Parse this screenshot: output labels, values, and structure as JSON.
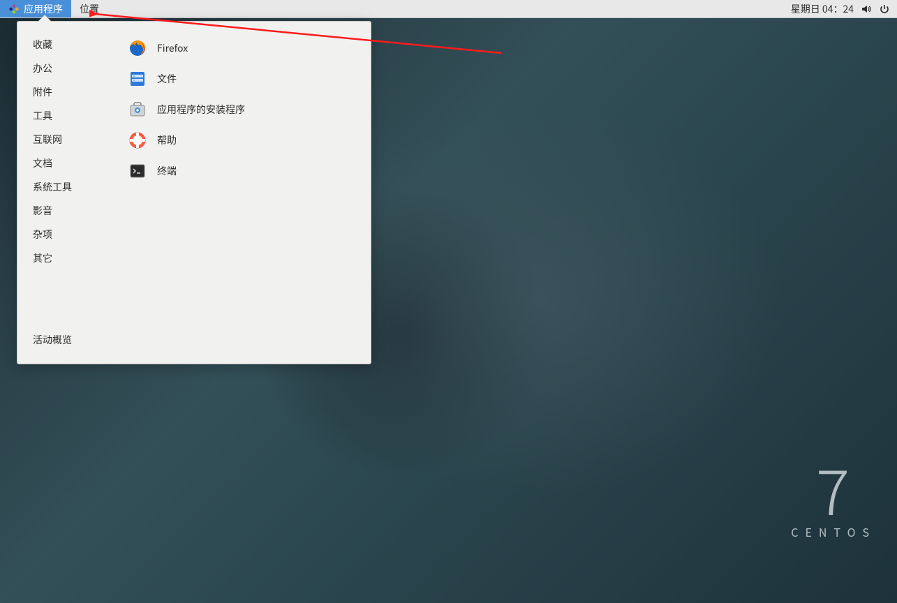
{
  "panel": {
    "applications_label": "应用程序",
    "places_label": "位置",
    "clock_text": "星期日 04：24"
  },
  "menu": {
    "categories": [
      "收藏",
      "办公",
      "附件",
      "工具",
      "互联网",
      "文档",
      "系统工具",
      "影音",
      "杂项",
      "其它"
    ],
    "apps": [
      {
        "icon": "firefox",
        "label": "Firefox"
      },
      {
        "icon": "files",
        "label": "文件"
      },
      {
        "icon": "software-install",
        "label": "应用程序的安装程序"
      },
      {
        "icon": "help",
        "label": "帮助"
      },
      {
        "icon": "terminal",
        "label": "终端"
      }
    ],
    "footer_label": "活动概览"
  },
  "brand": {
    "version": "7",
    "name": "CENTOS"
  }
}
